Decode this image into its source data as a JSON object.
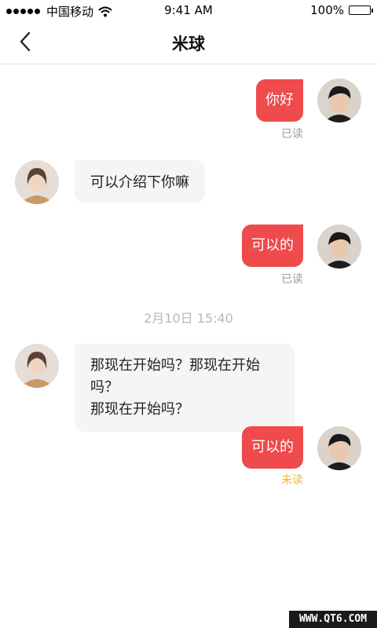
{
  "status_bar": {
    "carrier": "中国移动",
    "time": "9:41 AM",
    "battery": "100%",
    "signal_icon": "signal-dots",
    "wifi_icon": "wifi-icon",
    "battery_icon": "battery-icon"
  },
  "nav": {
    "back_icon": "chevron-left-icon",
    "title": "米球"
  },
  "messages": [
    {
      "direction": "out",
      "text": "你好",
      "status": "已读"
    },
    {
      "direction": "in",
      "text": "可以介绍下你嘛"
    },
    {
      "direction": "out",
      "text": "可以的",
      "status": "已读"
    },
    {
      "direction": "in",
      "text_line1": "那现在开始吗？那现在开始吗？",
      "text_line2": "那现在开始吗？"
    },
    {
      "direction": "out",
      "text": "可以的",
      "status": "未读"
    }
  ],
  "time_divider": "2月10日 15:40",
  "watermark": "WWW.QT6.COM",
  "colors": {
    "outgoing_bubble": "#ef4a4c",
    "incoming_bubble": "#f5f5f5",
    "read_status": "#9a9a9a",
    "unread_status": "#f2b232"
  }
}
